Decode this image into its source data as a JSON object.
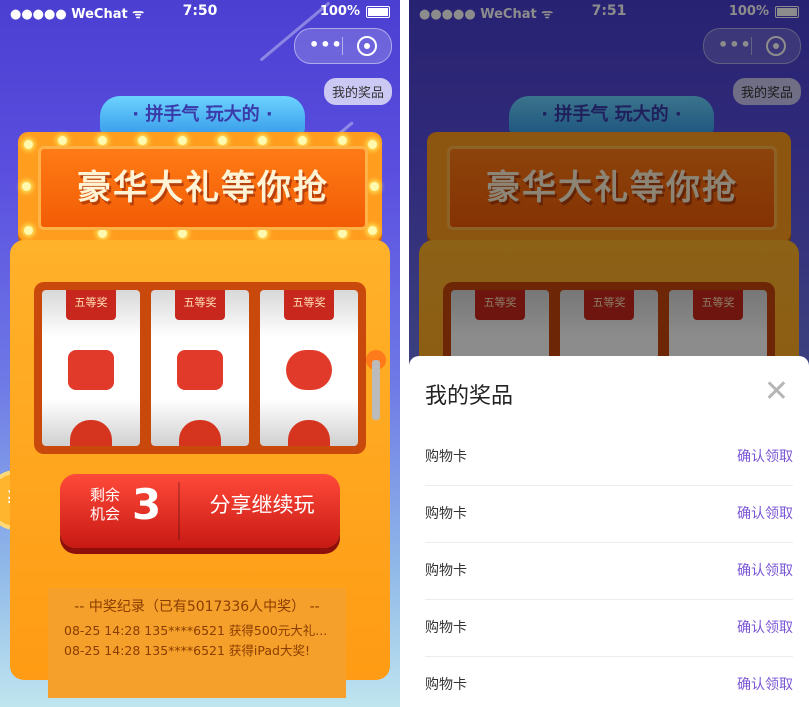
{
  "status_bar": {
    "carrier": "●●●●● WeChat ᯤ",
    "battery": "100%"
  },
  "left": {
    "time": "7:50",
    "capsule": {
      "more_icon": "more-dots-icon",
      "close_icon": "target-icon"
    },
    "my_prizes_button": "我的奖品",
    "slogan": "· 拼手气 玩大的 ·",
    "marquee_title": "豪华大礼等你抢",
    "reels": [
      {
        "tag": "五等奖"
      },
      {
        "tag": "五等奖"
      },
      {
        "tag": "五等奖"
      }
    ],
    "chance_label": "剩余机会",
    "chance_count": "3",
    "share_button": "分享继续玩",
    "records_title": "--  中奖纪录（已有5017336人中奖）  --",
    "records": [
      "08-25 14:28 135****6521 获得500元大礼...",
      "08-25 14:28 135****6521 获得iPad大奖!"
    ],
    "coin_symbol": "¥"
  },
  "right": {
    "time": "7:51",
    "my_prizes_button": "我的奖品",
    "slogan": "· 拼手气 玩大的 ·",
    "marquee_title": "豪华大礼等你抢",
    "reels": [
      {
        "tag": "五等奖"
      },
      {
        "tag": "五等奖"
      },
      {
        "tag": "五等奖"
      }
    ],
    "sheet": {
      "title": "我的奖品",
      "close": "✕",
      "items": [
        {
          "name": "购物卡",
          "action": "确认领取"
        },
        {
          "name": "购物卡",
          "action": "确认领取"
        },
        {
          "name": "购物卡",
          "action": "确认领取"
        },
        {
          "name": "购物卡",
          "action": "确认领取"
        },
        {
          "name": "购物卡",
          "action": "确认领取"
        }
      ]
    }
  },
  "colors": {
    "accent_purple": "#7a56d6",
    "button_red": "#e0281e",
    "machine_orange": "#ffa31f"
  }
}
